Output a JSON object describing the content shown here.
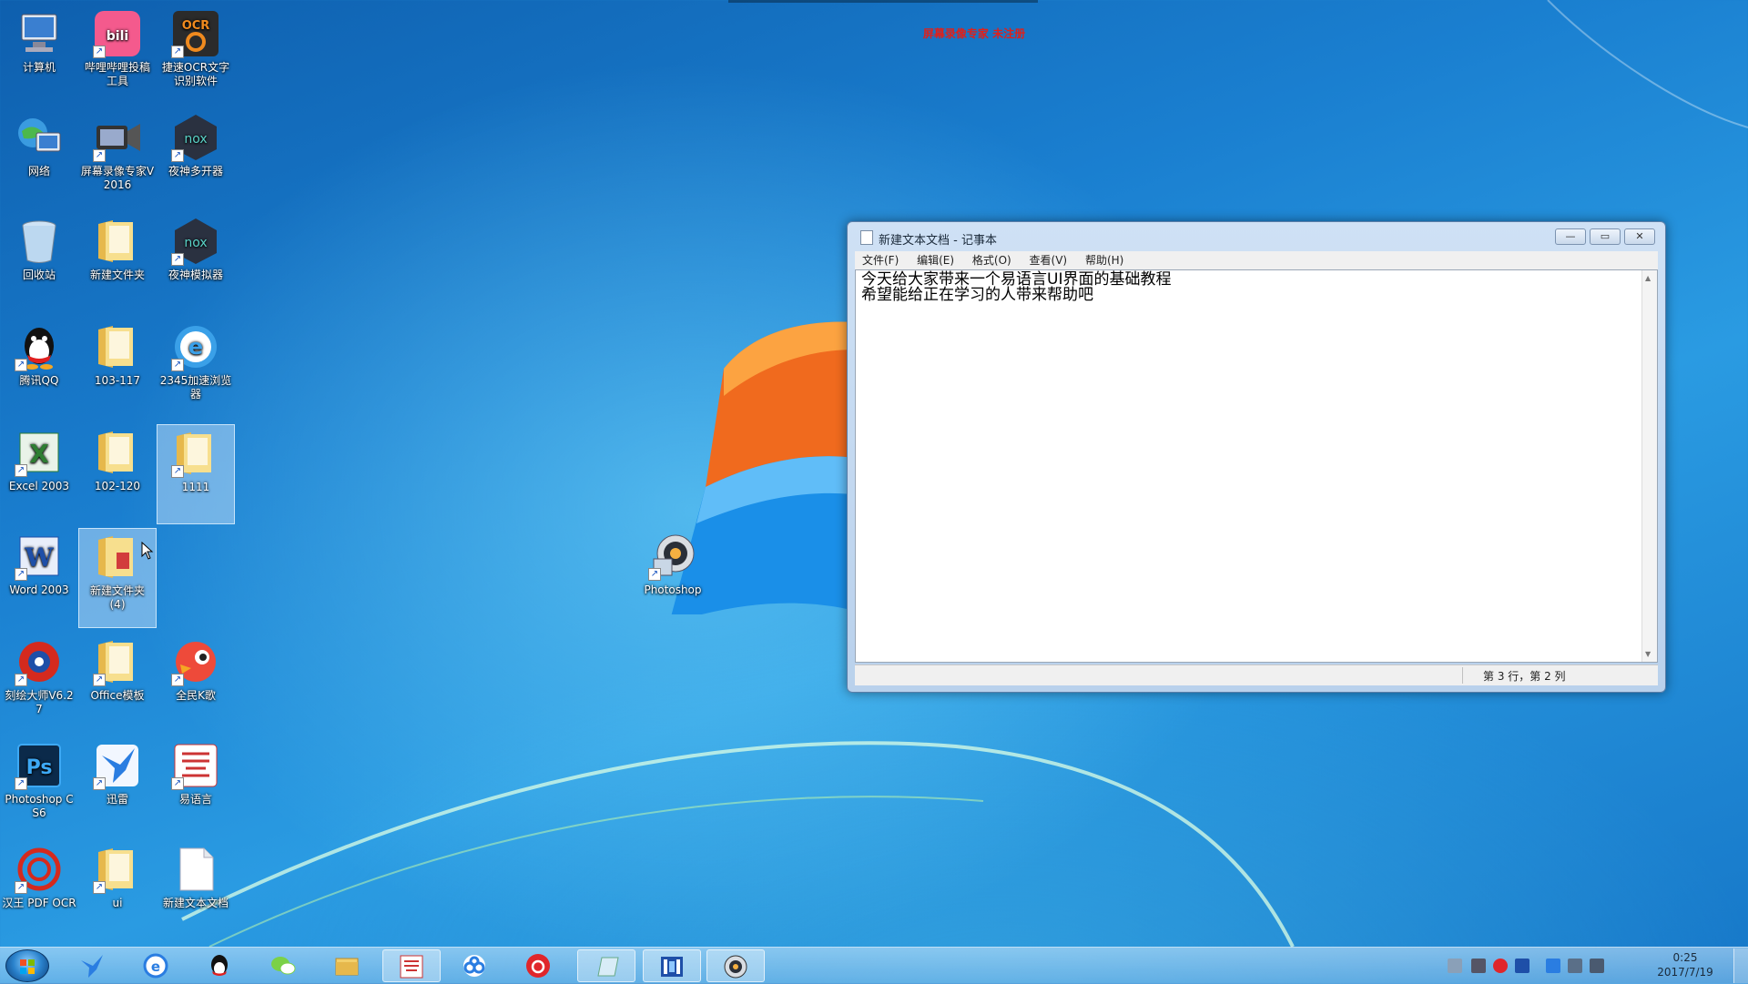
{
  "recording_title": "屏幕录像专家 未注册",
  "desktop_icons": [
    {
      "label": "计算机",
      "icon": "computer-icon"
    },
    {
      "label": "哔哩哔哩投稿工具",
      "icon": "bilibili-icon"
    },
    {
      "label": "捷速OCR文字识别软件",
      "icon": "ocr-icon"
    },
    {
      "label": "网络",
      "icon": "network-icon"
    },
    {
      "label": "屏幕录像专家V2016",
      "icon": "screen-recorder-icon"
    },
    {
      "label": "夜神多开器",
      "icon": "nox-multi-icon"
    },
    {
      "label": "回收站",
      "icon": "recycle-bin-icon"
    },
    {
      "label": "新建文件夹",
      "icon": "folder-icon"
    },
    {
      "label": "夜神模拟器",
      "icon": "nox-emulator-icon"
    },
    {
      "label": "腾讯QQ",
      "icon": "qq-icon"
    },
    {
      "label": "103-117",
      "icon": "folder-icon"
    },
    {
      "label": "2345加速浏览器",
      "icon": "browser-icon"
    },
    {
      "label": "Excel 2003",
      "icon": "excel-icon"
    },
    {
      "label": "102-120",
      "icon": "folder-icon"
    },
    {
      "label": "1111",
      "icon": "folder-icon"
    },
    {
      "label": "Word 2003",
      "icon": "word-icon"
    },
    {
      "label": "新建文件夹 (4)",
      "icon": "folder-icon"
    },
    {
      "label": "刻绘大师V6.27",
      "icon": "engraving-icon"
    },
    {
      "label": "Office模板",
      "icon": "folder-icon"
    },
    {
      "label": "全民K歌",
      "icon": "karaoke-icon"
    },
    {
      "label": "Photoshop CS6",
      "icon": "photoshop-icon"
    },
    {
      "label": "迅雷",
      "icon": "thunder-icon"
    },
    {
      "label": "易语言",
      "icon": "eyuyan-icon"
    },
    {
      "label": "汉王 PDF OCR",
      "icon": "hanwang-pdf-icon"
    },
    {
      "label": "ui",
      "icon": "folder-icon"
    },
    {
      "label": "新建文本文档",
      "icon": "text-file-icon"
    },
    {
      "label": "Photoshop",
      "icon": "photoshop-shortcut-icon"
    }
  ],
  "notepad": {
    "title": "新建文本文档 - 记事本",
    "menu": [
      "文件(F)",
      "编辑(E)",
      "格式(O)",
      "查看(V)",
      "帮助(H)"
    ],
    "content_lines": [
      "今天给大家带来一个易语言UI界面的基础教程",
      "希望能给正在学习的人带来帮助吧"
    ],
    "status": "第 3 行，第 2 列"
  },
  "taskbar": {
    "pinned": [
      "thunder-icon",
      "ie-icon",
      "qq-icon",
      "wechat-icon",
      "explorer-icon",
      "eyuyan-icon",
      "baidu-netdisk-icon",
      "netease-music-icon",
      "notepad-icon",
      "video-editor-icon",
      "photoshop-icon"
    ],
    "clock_time": "0:25",
    "clock_date": "2017/7/19"
  }
}
